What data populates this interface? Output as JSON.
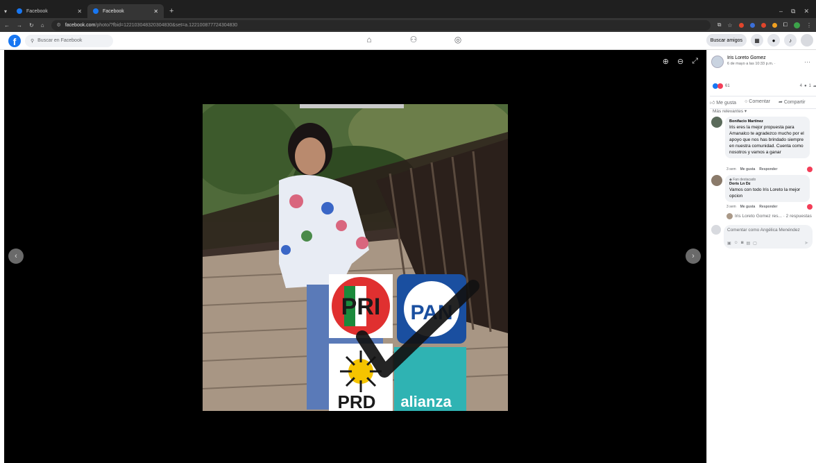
{
  "browser": {
    "tabs": [
      {
        "title": "Facebook"
      },
      {
        "title": "Facebook"
      }
    ],
    "url_host": "facebook.com",
    "url_path": "/photo/?fbid=122103048320304830&set=a.122100877724304830"
  },
  "header": {
    "search_placeholder": "Buscar en Facebook",
    "find_friends": "Buscar amigos"
  },
  "post": {
    "author": "Iris Loreto Gomez",
    "date": "6 de mayo a las 10:33 p.m. ·",
    "reactions_count": "61",
    "comments_count": "4",
    "shares_count": "1",
    "actions": [
      "Me gusta",
      "Comentar",
      "Compartir"
    ],
    "sort_label": "Más relevantes ▾"
  },
  "comments": [
    {
      "name": "Bonifacio Martínez",
      "text": "Iris eres la mejor propuesta para Amanalco te agradezco mucho por el apoyo que nos has brindado siempre en nuestra comunidad. Cuenta como nosotros y vamos a ganar",
      "time": "3 sem",
      "like": "Me gusta",
      "reply": "Responder"
    },
    {
      "badge": "Fan destacado",
      "name": "Doris Ln Dz",
      "text": "Vamos con todo Iris Loreto la mejor opcion",
      "time": "3 sem",
      "like": "Me gusta",
      "reply": "Responder"
    }
  ],
  "replies_preview": "Iris Loreto Gomez res... · 2 respuestas",
  "compose_placeholder": "Comentar como Angélica Menéndez",
  "photo": {
    "logo_pri": "PRI",
    "logo_pan": "PAN",
    "logo_prd": "PRD",
    "logo_alianza": "alianza"
  }
}
